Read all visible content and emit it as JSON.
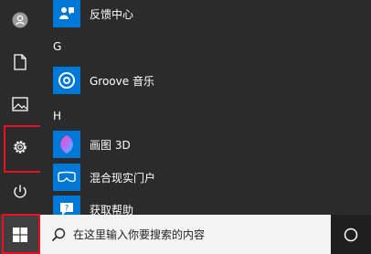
{
  "rail": {
    "items": [
      {
        "name": "account-icon"
      },
      {
        "name": "documents-icon"
      },
      {
        "name": "pictures-icon"
      },
      {
        "name": "settings-icon",
        "highlighted": true
      },
      {
        "name": "power-icon"
      }
    ]
  },
  "menu": {
    "apps_top": [
      {
        "label": "反馈中心",
        "icon": "feedback-hub-icon"
      }
    ],
    "group_g": "G",
    "apps_g": [
      {
        "label": "Groove 音乐",
        "icon": "groove-music-icon"
      }
    ],
    "group_h": "H",
    "apps_h": [
      {
        "label": "画图 3D",
        "icon": "paint-3d-icon"
      },
      {
        "label": "混合现实门户",
        "icon": "mixed-reality-portal-icon"
      },
      {
        "label": "获取帮助",
        "icon": "get-help-icon"
      }
    ]
  },
  "taskbar": {
    "start_highlighted": true,
    "search_placeholder": "在这里输入你要搜索的内容"
  },
  "colors": {
    "accent": "#0078d7",
    "highlight_border": "#e81123",
    "menu_bg": "#2b2b2b",
    "taskbar_bg": "#1f1f1f",
    "search_bg": "#f3f3f3"
  }
}
